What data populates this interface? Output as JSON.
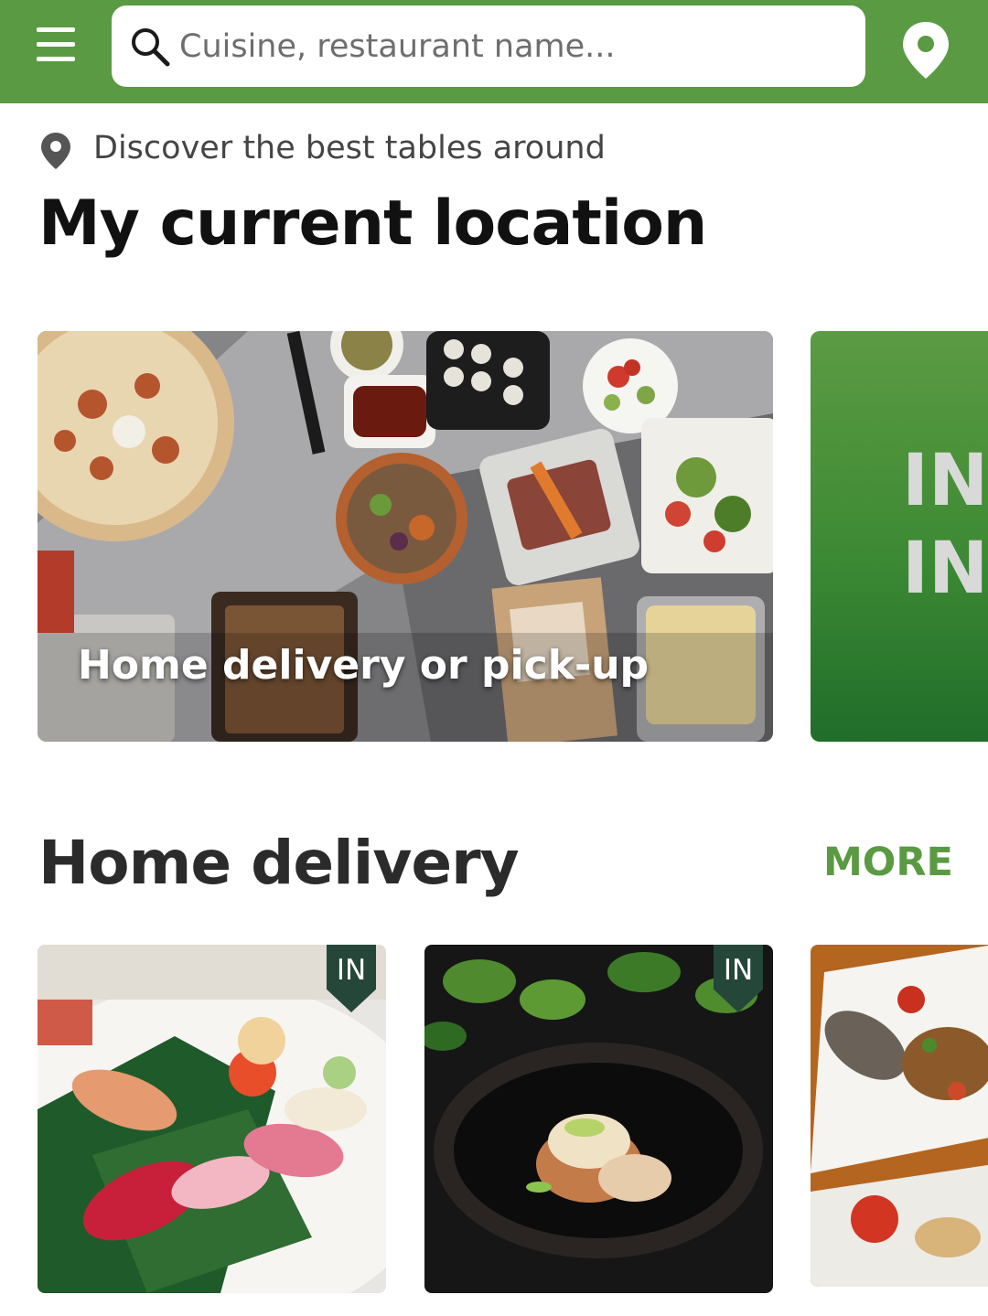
{
  "header": {
    "search_placeholder": "Cuisine, restaurant name...",
    "brand_color": "#5a9a42"
  },
  "location": {
    "subtitle": "Discover the best tables around",
    "title": "My current location"
  },
  "carousel": {
    "hero_label": "Home delivery or pick-up",
    "promo_lines": [
      "IN",
      "IN"
    ]
  },
  "home_delivery": {
    "title": "Home delivery",
    "more_label": "MORE",
    "cards": [
      {
        "tag": "IN",
        "image": "sushi-platter"
      },
      {
        "tag": "IN",
        "image": "dish-in-black-bowl"
      },
      {
        "tag": "",
        "image": "grilled-fish-plates"
      }
    ]
  },
  "icons": {
    "menu": "menu-icon",
    "search": "search-icon",
    "location": "location-pin-icon"
  }
}
